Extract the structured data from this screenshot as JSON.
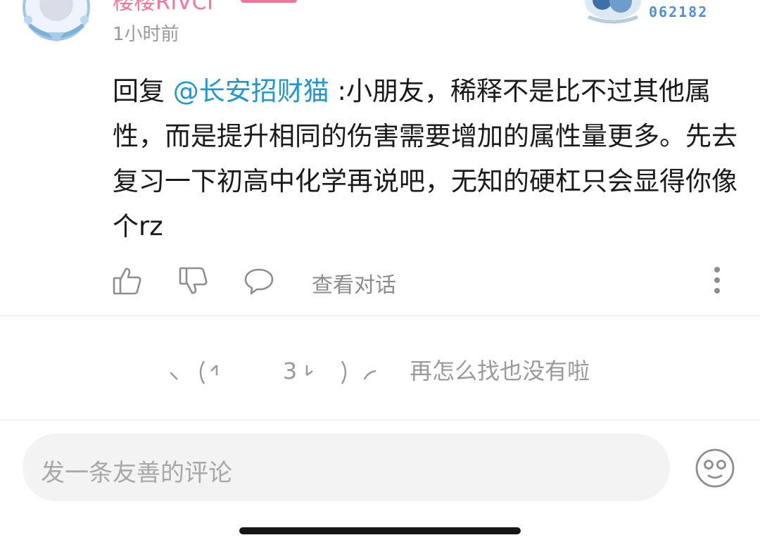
{
  "comment": {
    "username": "楼楼RIVCI",
    "time": "1小时前",
    "fan_number": "062182",
    "reply_prefix": "回复",
    "mention": "@长安招财猫",
    "body": ":小朋友，稀释不是比不过其他属性，而是提升相同的伤害需要增加的属性量更多。先去复习一下初高中化学再说吧，无知的硬杠只会显得你像个rz"
  },
  "actions": {
    "like_icon": "thumbs-up-icon",
    "dislike_icon": "thumbs-down-icon",
    "reply_icon": "chat-bubble-icon",
    "view_conversation": "查看对话",
    "more_icon": "vertical-ellipsis-icon"
  },
  "end_message": {
    "count": "3",
    "text": "再怎么找也没有啦"
  },
  "input": {
    "placeholder": "发一条友善的评论",
    "emoji_icon": "smiley-face-icon"
  },
  "colors": {
    "username": "#fb7299",
    "mention": "#1f98d2",
    "fan_number": "#4f8fd6",
    "muted": "#9a9a9a"
  }
}
